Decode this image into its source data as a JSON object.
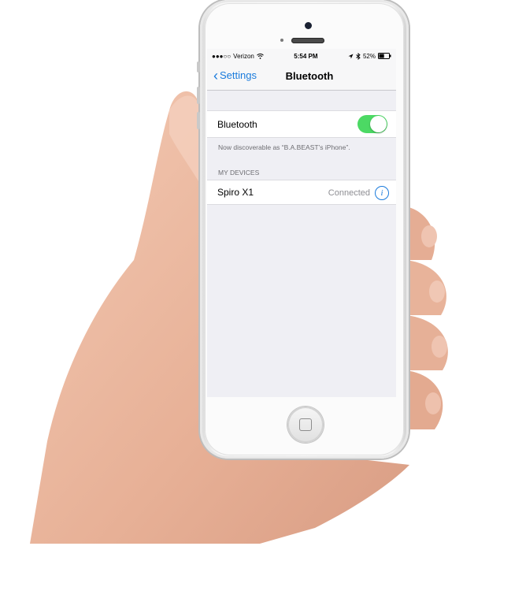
{
  "status_bar": {
    "signal": "●●●○○",
    "carrier": "Verizon",
    "wifi_icon": "wifi-icon",
    "time": "5:54 PM",
    "location_icon": "location-arrow-icon",
    "bluetooth_icon": "bluetooth-icon",
    "battery_percent": "52%",
    "battery_level": 0.52
  },
  "nav": {
    "back_label": "Settings",
    "title": "Bluetooth"
  },
  "bluetooth": {
    "label": "Bluetooth",
    "enabled": true,
    "discoverable_note": "Now discoverable as “B.A.BEAST’s iPhone”."
  },
  "my_devices": {
    "header": "MY DEVICES",
    "devices": [
      {
        "name": "Spiro X1",
        "status": "Connected",
        "info_symbol": "i"
      }
    ]
  },
  "colors": {
    "accent": "#1a7bdc",
    "toggle_on": "#4cd964",
    "background": "#efeff4"
  }
}
